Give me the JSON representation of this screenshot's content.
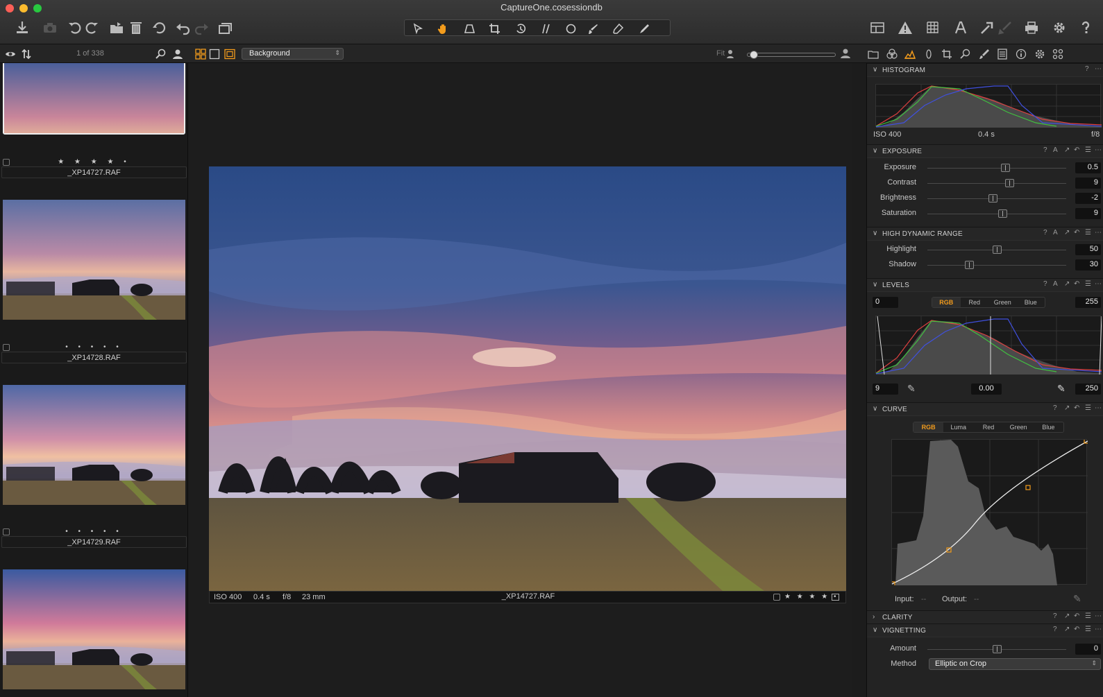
{
  "window": {
    "title": "CaptureOne.cosessiondb"
  },
  "colors": {
    "accent": "#f39c1c",
    "panel_bg": "#232323",
    "viewer_bg": "#1d1d1d"
  },
  "toolbar": {
    "left_icons": [
      "import-icon",
      "camera-icon",
      "rotate-left-icon",
      "rotate-right-icon",
      "move-to-folder-icon",
      "trash-icon",
      "reset-icon",
      "undo-icon",
      "redo-icon",
      "copy-adjustments-icon"
    ],
    "cursor_tools": [
      "select-cursor-icon",
      "hand-pan-icon",
      "keystone-icon",
      "crop-icon",
      "rotate-icon",
      "straighten-icon",
      "circle-mask-icon",
      "brush-icon",
      "eraser-icon",
      "picker-icon"
    ],
    "right_icons": [
      "grid-layout-icon",
      "warning-icon",
      "overlay-grid-icon",
      "text-icon",
      "apply-adjustments-icon",
      "copy-icon",
      "print-icon",
      "settings-gear-icon",
      "help-icon"
    ]
  },
  "browser_bar": {
    "counter": "1 of 338",
    "variant_select": "Background",
    "fit_label": "Fit"
  },
  "browser": {
    "thumbs": [
      {
        "filename": "_XP14727.RAF",
        "stars": "★ ★ ★ ★ •",
        "selected": true
      },
      {
        "filename": "_XP14728.RAF",
        "stars": "• • • • •",
        "selected": false
      },
      {
        "filename": "_XP14729.RAF",
        "stars": "• • • • •",
        "selected": false
      }
    ]
  },
  "viewer": {
    "caption": {
      "iso": "ISO 400",
      "shutter": "0.4 s",
      "aperture": "f/8",
      "focal": "23 mm",
      "filename": "_XP14727.RAF",
      "stars": "★ ★ ★ ★ •"
    }
  },
  "tools": {
    "tab_icons": [
      "library-folder-icon",
      "color-balance-icon",
      "exposure-tab-icon",
      "lens-icon",
      "crop-tab-icon",
      "details-icon",
      "local-adjust-icon",
      "adjustments-list-icon",
      "metadata-icon",
      "output-gear-icon",
      "batch-icon"
    ],
    "histogram": {
      "title": "HISTOGRAM",
      "iso": "ISO 400",
      "shutter": "0.4 s",
      "aperture": "f/8"
    },
    "exposure": {
      "title": "EXPOSURE",
      "rows": [
        {
          "label": "Exposure",
          "value": "0.5",
          "pos": 0.56
        },
        {
          "label": "Contrast",
          "value": "9",
          "pos": 0.59
        },
        {
          "label": "Brightness",
          "value": "-2",
          "pos": 0.47
        },
        {
          "label": "Saturation",
          "value": "9",
          "pos": 0.54
        }
      ]
    },
    "hdr": {
      "title": "HIGH DYNAMIC RANGE",
      "rows": [
        {
          "label": "Highlight",
          "value": "50",
          "pos": 0.5
        },
        {
          "label": "Shadow",
          "value": "30",
          "pos": 0.3
        }
      ]
    },
    "levels": {
      "title": "LEVELS",
      "tabs": [
        "RGB",
        "Red",
        "Green",
        "Blue"
      ],
      "active": "RGB",
      "in_low": "0",
      "in_high": "255",
      "out_low": "9",
      "mid": "0.00",
      "out_high": "250"
    },
    "curve": {
      "title": "CURVE",
      "tabs": [
        "RGB",
        "Luma",
        "Red",
        "Green",
        "Blue"
      ],
      "active": "RGB",
      "input_label": "Input:",
      "input_value": "--",
      "output_label": "Output:",
      "output_value": "--"
    },
    "clarity": {
      "title": "CLARITY"
    },
    "vignetting": {
      "title": "VIGNETTING",
      "amount_label": "Amount",
      "amount_value": "0",
      "amount_pos": 0.5,
      "method_label": "Method",
      "method_value": "Elliptic on Crop"
    }
  }
}
